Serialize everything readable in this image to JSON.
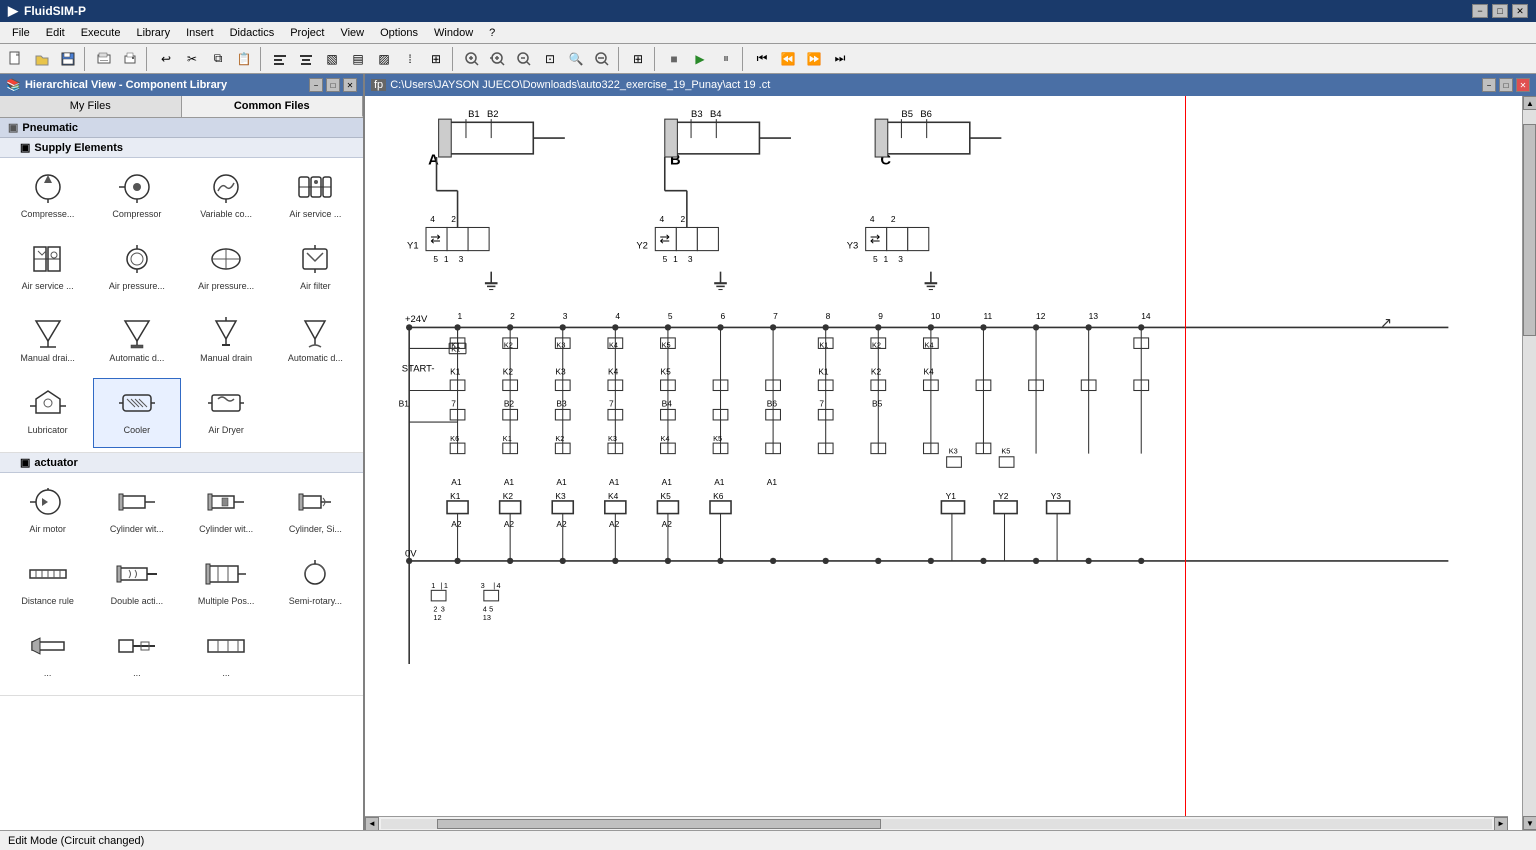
{
  "app": {
    "title": "FluidSIM-P",
    "icon": "fluidsim-icon"
  },
  "titlebar": {
    "title": "FluidSIM-P",
    "minimize": "−",
    "maximize": "□",
    "close": "✕"
  },
  "menubar": {
    "items": [
      "File",
      "Edit",
      "Execute",
      "Library",
      "Insert",
      "Didactics",
      "Project",
      "View",
      "Options",
      "Window",
      "?"
    ]
  },
  "library": {
    "title": "Hierarchical View - Component Library",
    "tabs": [
      "My Files",
      "Common Files"
    ],
    "active_tab": "Common Files",
    "categories": [
      {
        "name": "Pneumatic",
        "expanded": true,
        "subcategories": [
          {
            "name": "Supply Elements",
            "expanded": true,
            "components": [
              {
                "label": "Compresse...",
                "icon": "compressor-fixed"
              },
              {
                "label": "Compressor",
                "icon": "compressor"
              },
              {
                "label": "Variable co...",
                "icon": "variable-compressor"
              },
              {
                "label": "Air service ...",
                "icon": "air-service-unit"
              },
              {
                "label": "Air service ...",
                "icon": "air-service-2"
              },
              {
                "label": "Air pressure...",
                "icon": "air-pressure-1"
              },
              {
                "label": "Air pressure...",
                "icon": "air-pressure-2"
              },
              {
                "label": "Air filter",
                "icon": "air-filter"
              },
              {
                "label": "Manual drai...",
                "icon": "manual-drain"
              },
              {
                "label": "Automatic d...",
                "icon": "automatic-drain"
              },
              {
                "label": "Manual drain",
                "icon": "manual-drain-2"
              },
              {
                "label": "Automatic d...",
                "icon": "automatic-drain-2"
              },
              {
                "label": "Lubricator",
                "icon": "lubricator"
              },
              {
                "label": "Cooler",
                "icon": "cooler"
              },
              {
                "label": "Air Dryer",
                "icon": "air-dryer"
              }
            ]
          },
          {
            "name": "actuator",
            "expanded": true,
            "components": [
              {
                "label": "Air motor",
                "icon": "air-motor"
              },
              {
                "label": "Cylinder wit...",
                "icon": "cylinder-1"
              },
              {
                "label": "Cylinder wit...",
                "icon": "cylinder-2"
              },
              {
                "label": "Cylinder, Si...",
                "icon": "cylinder-single"
              },
              {
                "label": "Distance rule",
                "icon": "distance-rule"
              },
              {
                "label": "Double acti...",
                "icon": "double-acting"
              },
              {
                "label": "Multiple Pos...",
                "icon": "multiple-pos"
              },
              {
                "label": "Semi-rotary...",
                "icon": "semi-rotary"
              },
              {
                "label": "...",
                "icon": "actuator-1"
              },
              {
                "label": "...",
                "icon": "actuator-2"
              },
              {
                "label": "...",
                "icon": "actuator-3"
              }
            ]
          }
        ]
      }
    ]
  },
  "canvas": {
    "title": "C:\\Users\\JAYSON JUECO\\Downloads\\auto322_exercise_19_Punay\\act 19 .ct",
    "file_path": "C:\\Users\\JAYSON JUECO\\Downloads\\auto322_exercise_19_Punay\\act 19 .ct"
  },
  "statusbar": {
    "text": "Edit Mode (Circuit changed)"
  },
  "scrollbars": {
    "up": "▲",
    "down": "▼",
    "left": "◄",
    "right": "►"
  }
}
